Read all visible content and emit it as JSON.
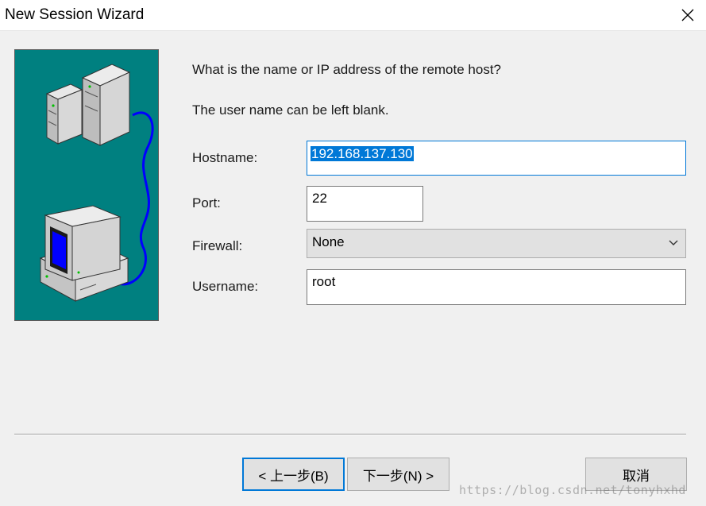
{
  "window": {
    "title": "New Session Wizard",
    "close_icon": "close-icon"
  },
  "illustration": {
    "background": "#008080",
    "icons": [
      "server-icon",
      "computer-icon",
      "cable-icon"
    ]
  },
  "prompt": {
    "question": "What is the name or IP address of the remote host?",
    "hint": "The user name can be left blank."
  },
  "form": {
    "hostname": {
      "label": "Hostname:",
      "value": "192.168.137.130"
    },
    "port": {
      "label": "Port:",
      "value": "22"
    },
    "firewall": {
      "label": "Firewall:",
      "value": "None"
    },
    "username": {
      "label": "Username:",
      "value": "root"
    }
  },
  "buttons": {
    "back": "< 上一步(B)",
    "next": "下一步(N) >",
    "cancel": "取消"
  },
  "watermark": "https://blog.csdn.net/tonyhxhd",
  "colors": {
    "accent": "#0078d7",
    "teal": "#008080",
    "monitor_screen": "#0000ff",
    "cable": "#0000ff"
  }
}
